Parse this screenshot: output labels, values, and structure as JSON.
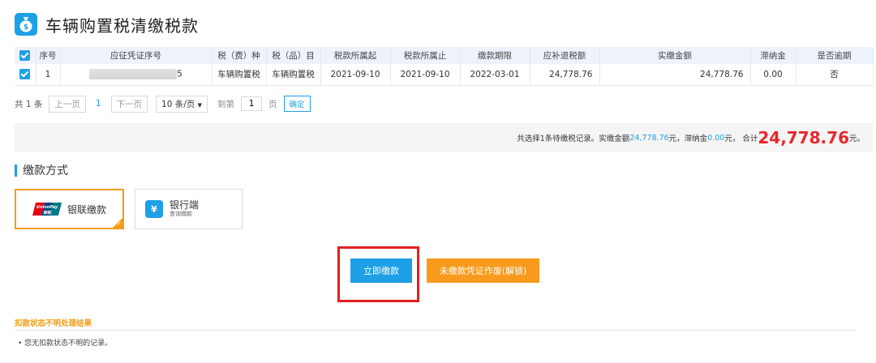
{
  "page": {
    "title": "车辆购置税清缴税款"
  },
  "table": {
    "headers": [
      "序号",
      "应征凭证序号",
      "税（费）种",
      "税（品）目",
      "税款所属起",
      "税款所属止",
      "缴款期限",
      "应补退税额",
      "实缴金额",
      "滞纳金",
      "是否逾期"
    ],
    "rows": [
      {
        "index": "1",
        "voucher_suffix": "5",
        "tax_type": "车辆购置税",
        "tax_item": "车辆购置税",
        "period_start": "2021-09-10",
        "period_end": "2021-09-10",
        "deadline": "2022-03-01",
        "refund_amount": "24,778.76",
        "paid_amount": "24,778.76",
        "late_fee": "0.00",
        "overdue": "否"
      }
    ]
  },
  "pager": {
    "total": "共 1 条",
    "prev": "上一页",
    "current": "1",
    "next": "下一页",
    "page_size": "10 条/页",
    "goto_label": "到第",
    "goto_value": "1",
    "page_unit": "页",
    "confirm": "确定"
  },
  "summary": {
    "part1": "共选择1条待缴税记录。实缴金额",
    "paid": "24,778.76",
    "part2": " 元，滞纳金 ",
    "late_fee": "0.00",
    "part3": "元， 合计",
    "total": "24,778.76",
    "part4": "元。"
  },
  "payment": {
    "section_title": "缴款方式",
    "unionpay_label": "银联缴款",
    "unionpay_logo_text": "UnionPay 银联",
    "bank_label": "银行端",
    "bank_sub": "查询缴款",
    "bank_icon": "¥"
  },
  "buttons": {
    "pay_now": "立即缴款",
    "void_voucher": "未缴款凭证作废(解锁)"
  },
  "status": {
    "title": "扣款状态不明处理结果",
    "item": "•  您无扣款状态不明的记录。"
  },
  "colors": {
    "accent": "#1ea0e6",
    "orange": "#f89a1c",
    "red": "#e8262b",
    "highlight": "#e02020"
  }
}
